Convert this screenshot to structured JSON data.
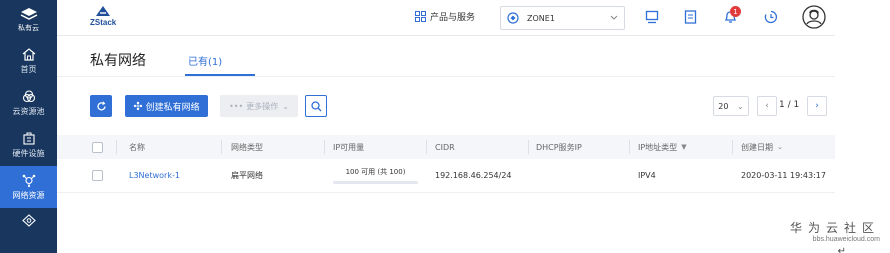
{
  "sidebar": {
    "logo_label": "私有云",
    "items": [
      {
        "label": "首页",
        "icon": "home-icon"
      },
      {
        "label": "云资源池",
        "icon": "cloud-resource-icon"
      },
      {
        "label": "硬件设施",
        "icon": "hardware-icon"
      },
      {
        "label": "网络资源",
        "icon": "network-icon",
        "active": true
      },
      {
        "label": "",
        "icon": "settings-diamond-icon"
      }
    ]
  },
  "header": {
    "brand": "ZStack",
    "products_label": "产品与服务",
    "zone_label": "ZONE1",
    "notification_count": "1"
  },
  "page": {
    "title": "私有网络",
    "tab_label": "已有(1)"
  },
  "toolbar": {
    "create_label": "创建私有网络",
    "more_label": "更多操作"
  },
  "pagination": {
    "page_size": "20",
    "page_text": "1 / 1"
  },
  "table": {
    "columns": [
      "名称",
      "网络类型",
      "IP可用量",
      "CIDR",
      "DHCP服务IP",
      "IP地址类型",
      "创建日期"
    ],
    "rows": [
      {
        "name": "L3Network-1",
        "type": "扁平网络",
        "ip_usage": "100 可用 (共 100)",
        "cidr": "192.168.46.254/24",
        "dhcp_ip": "",
        "ip_version": "IPV4",
        "created": "2020-03-11 19:43:17"
      }
    ]
  },
  "watermark": {
    "title": "华为云社区",
    "url": "bbs.huaweicloud.com"
  },
  "colors": {
    "sidebar_bg": "#19375e",
    "accent": "#2f6fd6",
    "badge": "#e23b3b"
  }
}
